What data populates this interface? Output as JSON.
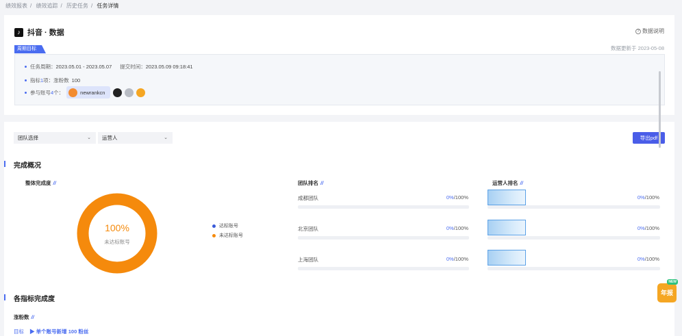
{
  "breadcrumb": [
    "绩效报表",
    "绩效追踪",
    "历史任务",
    "任务详情"
  ],
  "header": {
    "platform_icon": "douyin-icon",
    "title": "抖音 · 数据",
    "help_label": "数据说明",
    "period_tag": "周期目标",
    "update_text": "数据更新于 2023-05-08"
  },
  "info": {
    "period_label": "任务周期：",
    "period_value": "2023.05.01 - 2023.05.07",
    "submit_label": "提交时间：",
    "submit_value": "2023.05.09 09:18:41",
    "metric_label": "指标 ",
    "metric_count": "1",
    "metric_unit": " 项：",
    "metric_name": "涨粉数",
    "metric_value": "100",
    "accounts_label": "参与账号 ",
    "accounts_count": "4",
    "accounts_unit": " 个：",
    "account_name": "newrankcn"
  },
  "filters": {
    "team_select": "团队选择",
    "operator_select": "运营人",
    "export_label": "导出pdf"
  },
  "overview": {
    "section_title": "完成概况",
    "overall_title": "整体完成度",
    "donut_percent": "100%",
    "donut_caption": "未达标账号",
    "legend": [
      {
        "label": "达标账号",
        "color": "#3a5bd9"
      },
      {
        "label": "未达标账号",
        "color": "#f58a0c"
      }
    ],
    "team_rank_title": "团队排名",
    "operator_rank_title": "运营人排名",
    "teams": [
      {
        "name": "成都团队",
        "done": "0%",
        "total": "/100%"
      },
      {
        "name": "北京团队",
        "done": "0%",
        "total": "/100%"
      },
      {
        "name": "上海团队",
        "done": "0%",
        "total": "/100%"
      }
    ],
    "operators": [
      {
        "done": "0%",
        "total": "/100%"
      },
      {
        "done": "0%",
        "total": "/100%"
      },
      {
        "done": "0%",
        "total": "/100%"
      }
    ]
  },
  "metrics": {
    "section_title": "各指标完成度",
    "metric_title": "涨粉数",
    "goal_label": "目标",
    "goal_text": "▶ 单个账号新增 100 粉丝"
  },
  "badge": {
    "label": "年报",
    "new": "NEW"
  }
}
